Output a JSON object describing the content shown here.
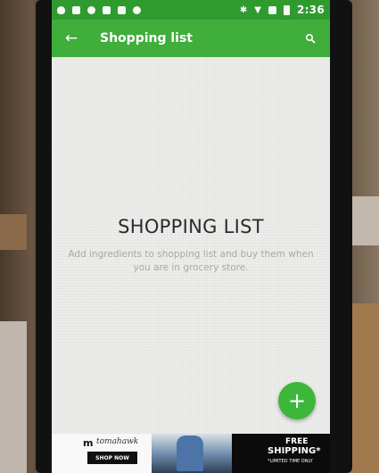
{
  "status_bar": {
    "time": "2:36",
    "left_icons": [
      "shield-icon",
      "message-icon",
      "alarm-icon",
      "tool-icon",
      "lock-icon",
      "android-icon"
    ],
    "right_icons": [
      "bluetooth-icon",
      "wifi-icon",
      "vibrate-icon",
      "battery-icon"
    ]
  },
  "app_bar": {
    "title": "Shopping list",
    "back_glyph": "←",
    "search_icon": "search-icon"
  },
  "empty_state": {
    "title": "SHOPPING LIST",
    "description": "Add ingredients to shopping list and buy them when you are in grocery store."
  },
  "fab": {
    "label": "+"
  },
  "ad": {
    "brand_letter": "m",
    "brand_script": "tomahawk",
    "shop_now": "SHOP NOW",
    "free": "FREE",
    "shipping": "SHIPPING*",
    "limited": "*LIMITED TIME ONLY"
  },
  "colors": {
    "status_bar": "#2f9b2f",
    "app_bar": "#3fae3b",
    "fab": "#3cb73a"
  }
}
